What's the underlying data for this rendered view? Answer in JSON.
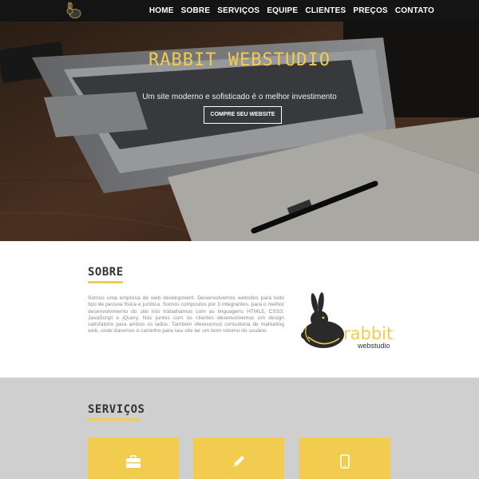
{
  "nav": {
    "logo_icon": "rabbit-logo-icon",
    "items": [
      "Home",
      "Sobre",
      "Serviços",
      "Equipe",
      "Clientes",
      "Preços",
      "Contato"
    ]
  },
  "hero": {
    "title": "RABBIT WEBSTUDIO",
    "subtitle": "Um site moderno e sofisticado é o melhor investimento",
    "cta_label": "Compre seu website"
  },
  "sobre": {
    "title": "SOBRE",
    "text": "Somos uma empresa de web development. Desenvolvemos websites para todo tipo de pessoa física e jurídica. Somos compostos por 3 integrantes, para o melhor desenvolvimento do site nós trabalhamos com as linguagens HTML5, CSS3, JavaScript e jQuery. Nós juntos com os clientes desenvolvemos um design satisfatório para ambos os lados. Também oferecemos consultoria de marketing web, onde daremos o caminho para seu site ter um bom retorno do usuário.",
    "logo_word": "rabbit",
    "logo_sub": "webstudio"
  },
  "servicos": {
    "title": "SERVIÇOS",
    "cards": [
      {
        "icon": "briefcase-icon"
      },
      {
        "icon": "pencil-icon"
      },
      {
        "icon": "tablet-icon"
      }
    ]
  },
  "colors": {
    "accent": "#f2cc4f",
    "nav_bg": "#141414",
    "services_bg": "#cfcfcf"
  }
}
